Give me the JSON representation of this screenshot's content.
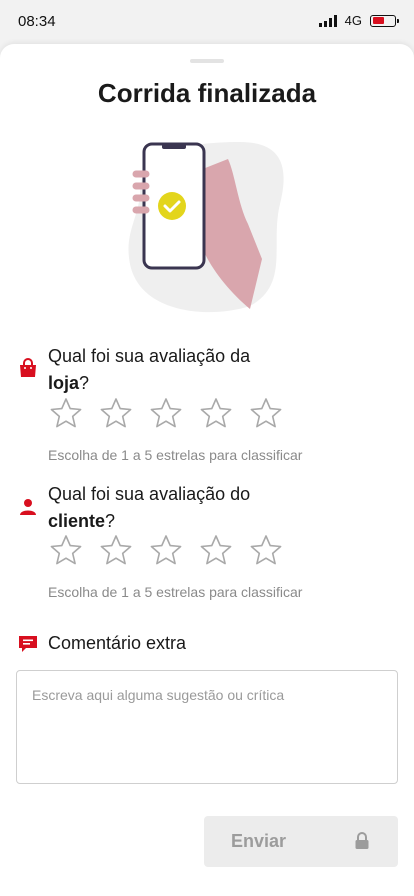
{
  "status_bar": {
    "time": "08:34",
    "network": "4G",
    "battery_level": 0.55
  },
  "title": "Corrida finalizada",
  "store_rating": {
    "question_line1": "Qual foi sua avaliação da",
    "question_bold": "loja",
    "question_suffix": "?",
    "stars_selected": 0,
    "stars_total": 5,
    "hint": "Escolha de 1 a 5 estrelas para classificar",
    "icon": "shopping-bag-icon"
  },
  "customer_rating": {
    "question_line1": "Qual foi sua avaliação do",
    "question_bold": "cliente",
    "question_suffix": "?",
    "stars_selected": 0,
    "stars_total": 5,
    "hint": "Escolha de 1 a 5 estrelas para classificar",
    "icon": "person-icon"
  },
  "comment": {
    "label": "Comentário extra",
    "placeholder": "Escreva aqui alguma sugestão ou crítica",
    "value": "",
    "icon": "message-icon"
  },
  "send_button": {
    "label": "Enviar",
    "icon": "lock-icon",
    "disabled": true
  },
  "colors": {
    "accent": "#d80f1f",
    "star_outline": "#a9a9a9",
    "phone_check": "#e3d51c",
    "hand": "#d9a6ad"
  }
}
